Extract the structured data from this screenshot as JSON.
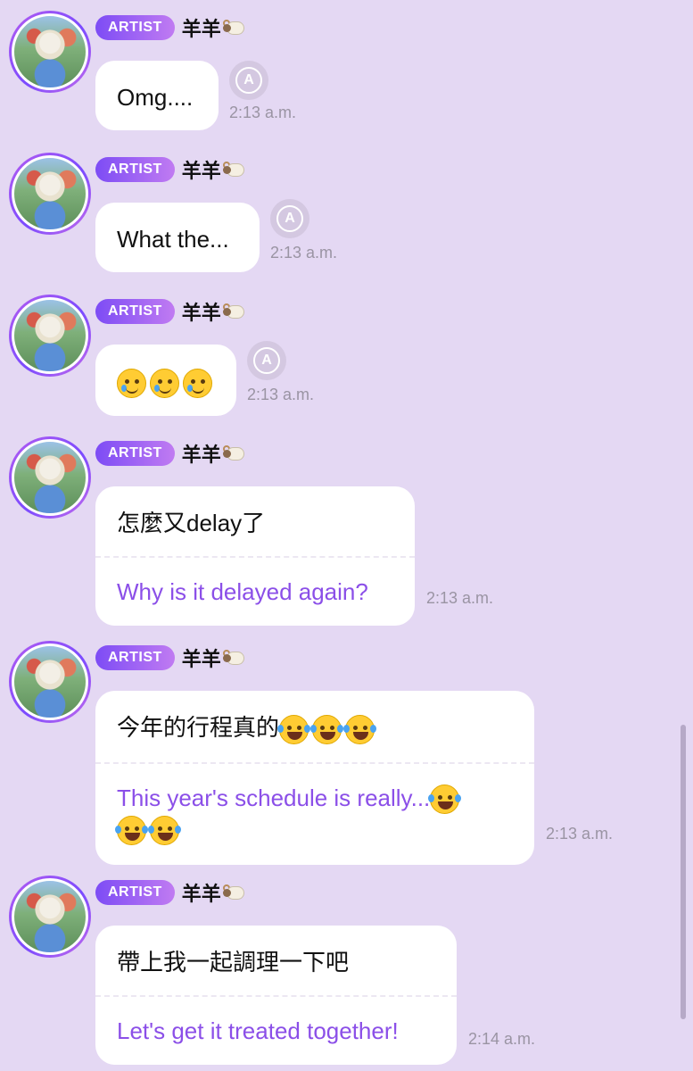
{
  "badge_label": "ARTIST",
  "sender_name": "羊羊",
  "icons": {
    "sender_suffix": "sheep-icon",
    "translate": "translate-icon"
  },
  "colors": {
    "background": "#e4d8f3",
    "badge_start": "#7d4cf5",
    "badge_end": "#c07bf2",
    "translation_text": "#8b4fe8"
  },
  "messages": [
    {
      "text": "Omg....",
      "time": "2:13 a.m."
    },
    {
      "text": "What the...",
      "time": "2:13 a.m."
    },
    {
      "text": "",
      "emoji": [
        "smiling-face-with-tear",
        "smiling-face-with-tear",
        "smiling-face-with-tear"
      ],
      "time": "2:13 a.m."
    },
    {
      "text": "怎麼又delay了",
      "translation": "Why is it delayed again?",
      "time": "2:13 a.m."
    },
    {
      "text": "今年的行程真的",
      "emoji": [
        "face-with-tears-of-joy",
        "face-with-tears-of-joy",
        "face-with-tears-of-joy"
      ],
      "translation": "This year's schedule is really...",
      "translation_emoji": [
        "face-with-tears-of-joy",
        "face-with-tears-of-joy",
        "face-with-tears-of-joy"
      ],
      "time": "2:13 a.m."
    },
    {
      "text": "帶上我一起調理一下吧",
      "translation": "Let's get it treated together!",
      "time": "2:14 a.m."
    }
  ]
}
